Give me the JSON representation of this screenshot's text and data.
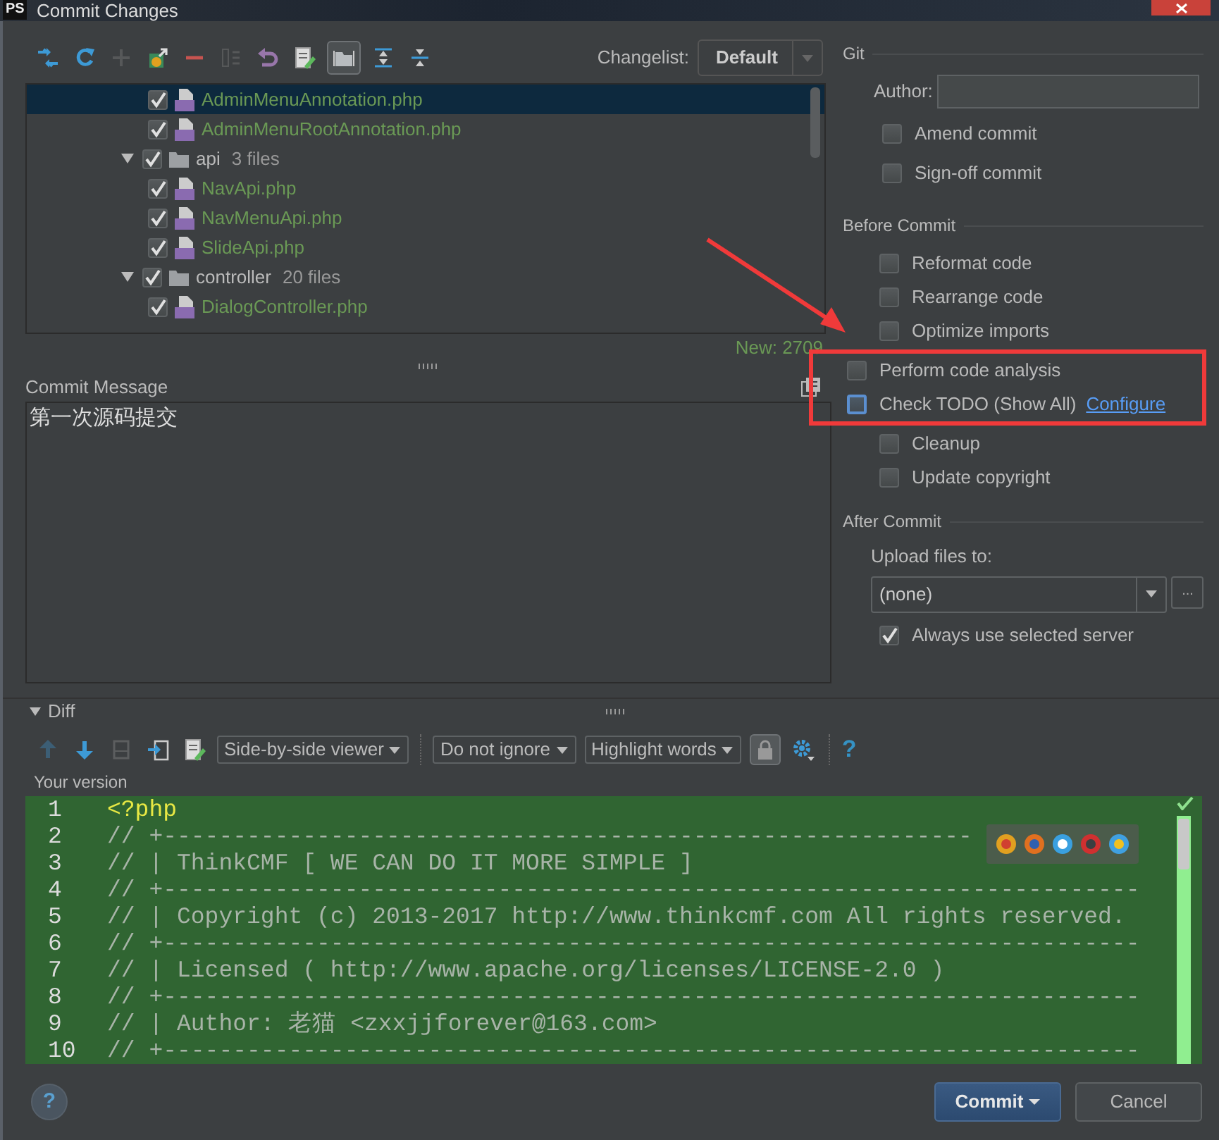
{
  "window": {
    "title": "Commit Changes",
    "app_badge": "PS"
  },
  "file_toolbar": [
    {
      "kind": "arrows",
      "disabled": false,
      "pressed": false
    },
    {
      "kind": "refresh",
      "disabled": false,
      "pressed": false
    },
    {
      "kind": "add",
      "disabled": true,
      "pressed": false
    },
    {
      "kind": "move",
      "disabled": false,
      "pressed": false
    },
    {
      "kind": "remove",
      "disabled": false,
      "pressed": false
    },
    {
      "kind": "diff",
      "disabled": true,
      "pressed": false
    },
    {
      "kind": "undo",
      "disabled": false,
      "pressed": false
    },
    {
      "kind": "edit",
      "disabled": false,
      "pressed": false
    },
    {
      "kind": "folder",
      "disabled": false,
      "pressed": true
    },
    {
      "kind": "expand",
      "disabled": false,
      "pressed": false
    },
    {
      "kind": "collapse",
      "disabled": false,
      "pressed": false
    }
  ],
  "changelist": {
    "label": "Changelist:",
    "value": "Default"
  },
  "file_tree": [
    {
      "kind": "group",
      "children": [
        {
          "kind": "file",
          "name": "AdminMenuAnnotation.php",
          "checked": true,
          "selected": true
        },
        {
          "kind": "file",
          "name": "AdminMenuRootAnnotation.php",
          "checked": true,
          "selected": false
        }
      ]
    },
    {
      "kind": "folder",
      "name": "api",
      "count": "3 files",
      "checked": true,
      "expanded": true,
      "selected": false,
      "children": [
        {
          "kind": "file",
          "name": "NavApi.php",
          "checked": true,
          "selected": false
        },
        {
          "kind": "file",
          "name": "NavMenuApi.php",
          "checked": true,
          "selected": false
        },
        {
          "kind": "file",
          "name": "SlideApi.php",
          "checked": true,
          "selected": false
        }
      ]
    },
    {
      "kind": "folder",
      "name": "controller",
      "count": "20 files",
      "checked": true,
      "expanded": true,
      "selected": false,
      "children": [
        {
          "kind": "file",
          "name": "DialogController.php",
          "checked": true,
          "selected": false
        }
      ]
    }
  ],
  "new_count": "New: 2709",
  "commit_message": {
    "label": "Commit Message",
    "value": "第一次源码提交"
  },
  "git": {
    "title": "Git",
    "author_label": "Author:",
    "options": [
      {
        "label": "Amend commit",
        "checked": false
      },
      {
        "label": "Sign-off commit",
        "checked": false
      }
    ]
  },
  "before_commit": {
    "title": "Before Commit",
    "options": [
      {
        "label": "Reformat code",
        "checked": false,
        "focused": false,
        "highlighted": false
      },
      {
        "label": "Rearrange code",
        "checked": false,
        "focused": false,
        "highlighted": false
      },
      {
        "label": "Optimize imports",
        "checked": false,
        "focused": false,
        "highlighted": false
      },
      {
        "label": "Perform code analysis",
        "checked": false,
        "focused": false,
        "highlighted": true
      },
      {
        "label": "Check TODO (Show All)",
        "link": "Configure",
        "checked": false,
        "focused": true,
        "highlighted": true
      },
      {
        "label": "Cleanup",
        "checked": false,
        "focused": false,
        "highlighted": false
      },
      {
        "label": "Update copyright",
        "checked": false,
        "focused": false,
        "highlighted": false
      }
    ]
  },
  "after_commit": {
    "title": "After Commit",
    "upload_label": "Upload files to:",
    "upload_value": "(none)",
    "more_button": "...",
    "options": [
      {
        "label": "Always use selected server",
        "checked": true
      }
    ]
  },
  "diff": {
    "title": "Diff",
    "expanded": true,
    "toolbar": [
      {
        "kind": "up",
        "disabled": true
      },
      {
        "kind": "down",
        "disabled": false
      },
      {
        "kind": "window",
        "disabled": true
      },
      {
        "kind": "import",
        "disabled": false
      },
      {
        "kind": "edit",
        "disabled": false
      },
      {
        "kind": "dropdown",
        "label": "Side-by-side viewer"
      },
      {
        "kind": "separator"
      },
      {
        "kind": "dropdown",
        "label": "Do not ignore"
      },
      {
        "kind": "dropdown",
        "label": "Highlight words"
      },
      {
        "kind": "lock",
        "pressed": true
      },
      {
        "kind": "gear",
        "disabled": false
      },
      {
        "kind": "separator"
      },
      {
        "kind": "help",
        "label": "?"
      }
    ],
    "side_label": "Your version",
    "lines": [
      {
        "number": "1",
        "kind": "tag",
        "text": "<?php"
      },
      {
        "number": "2",
        "kind": "comment",
        "text": "// +----------------------------------------------------------"
      },
      {
        "number": "3",
        "kind": "comment",
        "text": "// | ThinkCMF [ WE CAN DO IT MORE SIMPLE ]"
      },
      {
        "number": "4",
        "kind": "comment",
        "text": "// +----------------------------------------------------------------------"
      },
      {
        "number": "5",
        "kind": "comment",
        "text": "// | Copyright (c) 2013-2017 http://www.thinkcmf.com All rights reserved."
      },
      {
        "number": "6",
        "kind": "comment",
        "text": "// +----------------------------------------------------------------------"
      },
      {
        "number": "7",
        "kind": "comment",
        "text": "// | Licensed ( http://www.apache.org/licenses/LICENSE-2.0 )"
      },
      {
        "number": "8",
        "kind": "comment",
        "text": "// +----------------------------------------------------------------------"
      },
      {
        "number": "9",
        "kind": "comment",
        "text": "// | Author: 老猫 <zxxjjforever@163.com>"
      },
      {
        "number": "10",
        "kind": "comment",
        "text": "// +----------------------------------------------------------------------"
      }
    ]
  },
  "footer": {
    "help": "?",
    "buttons": [
      {
        "label": "Commit",
        "kind": "primary",
        "menu": true
      },
      {
        "label": "Cancel",
        "kind": "secondary",
        "menu": false
      }
    ]
  }
}
